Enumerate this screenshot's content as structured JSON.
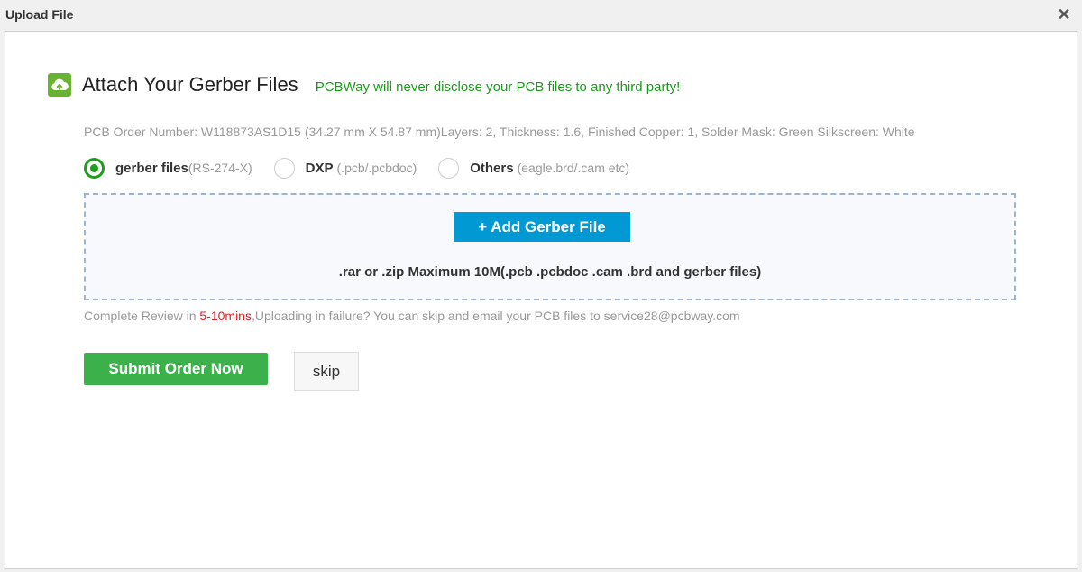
{
  "dialog": {
    "title": "Upload File",
    "close_glyph": "✕"
  },
  "header": {
    "icon": "cloud-upload-icon",
    "title": "Attach Your Gerber Files",
    "notice": "PCBWay will never disclose your PCB files to any third party!"
  },
  "order_info": "PCB Order Number: W118873AS1D15 (34.27 mm X 54.87 mm)Layers: 2, Thickness: 1.6, Finished Copper: 1, Solder Mask: Green Silkscreen: White",
  "file_types": [
    {
      "name": "gerber files",
      "hint": "(RS-274-X)",
      "selected": true
    },
    {
      "name": "DXP",
      "hint": "(.pcb/.pcbdoc)",
      "selected": false
    },
    {
      "name": "Others",
      "hint": "(eagle.brd/.cam etc)",
      "selected": false
    }
  ],
  "upload": {
    "add_label": "+ Add Gerber File",
    "formats": ".rar or .zip Maximum 10M(.pcb .pcbdoc .cam .brd and gerber files)"
  },
  "review": {
    "prefix": "Complete Review in ",
    "highlight": "5-10mins",
    "suffix": ",Uploading in failure? You can skip and email your PCB files to service28@pcbway.com"
  },
  "actions": {
    "submit_label": "Submit Order Now",
    "skip_label": "skip"
  },
  "colors": {
    "accent_green": "#3cb04a",
    "notice_green": "#1a9c1a",
    "add_button_blue": "#0099d4",
    "highlight_red": "#e02020"
  }
}
